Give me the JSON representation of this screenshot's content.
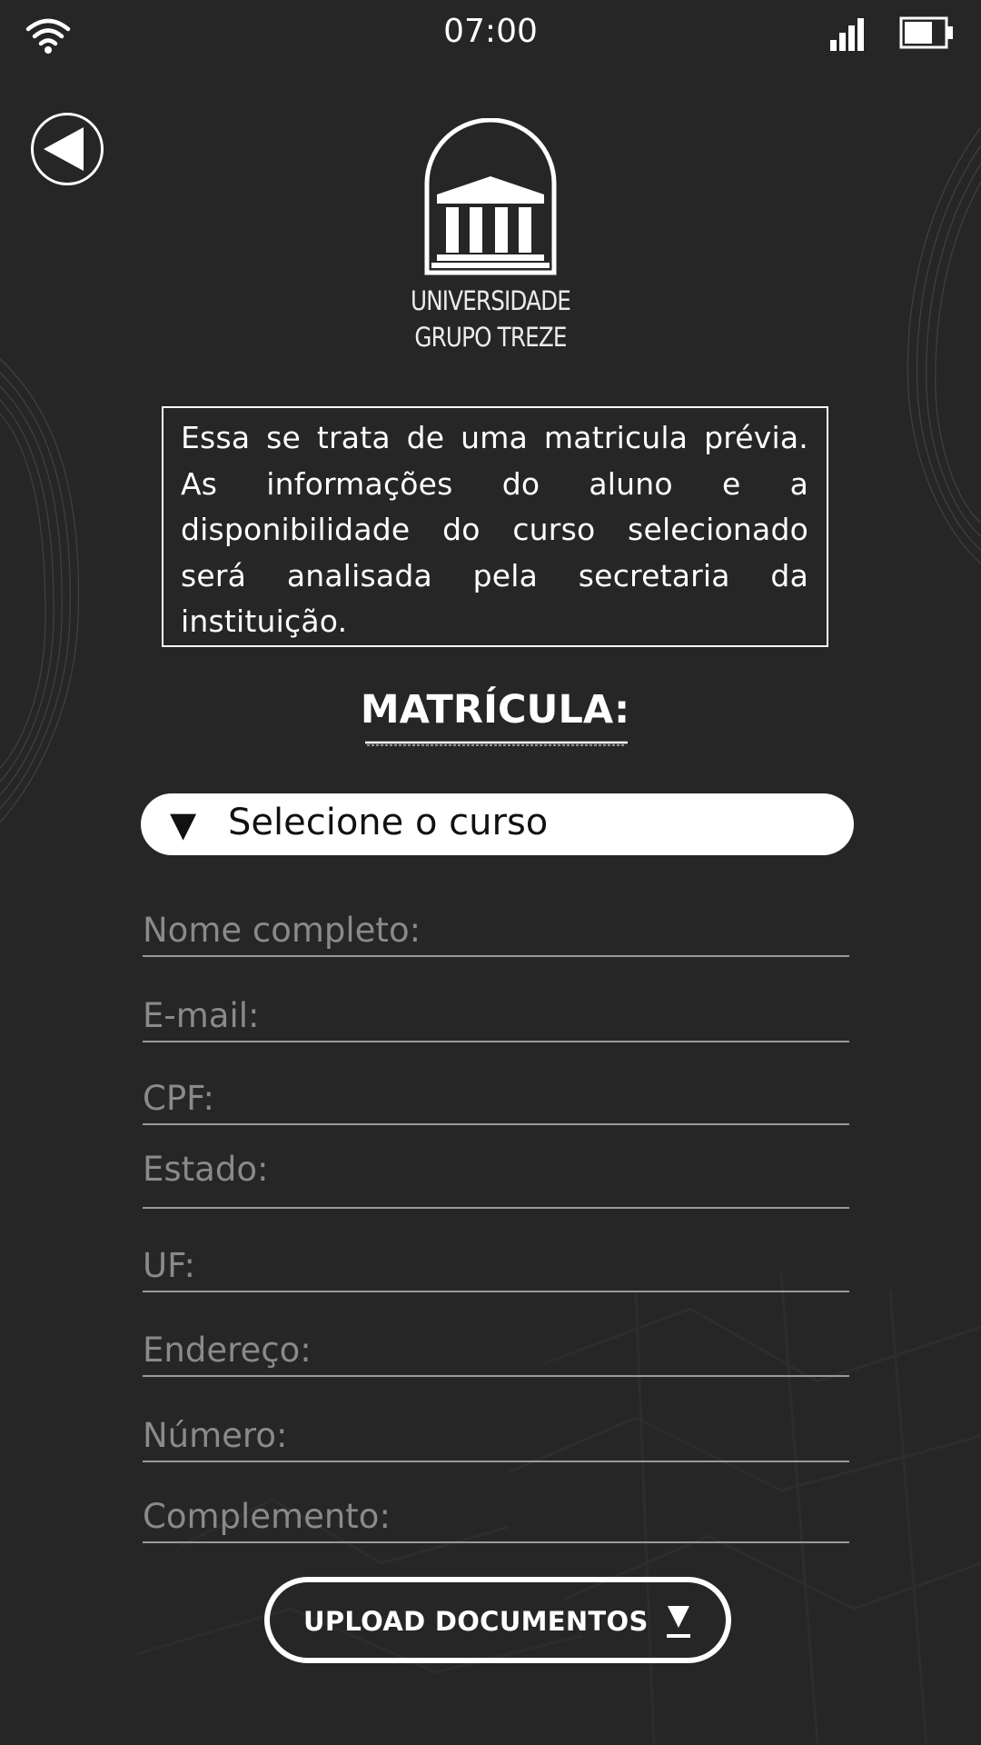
{
  "status_bar": {
    "time": "07:00",
    "icons": [
      "wifi-icon",
      "signal-icon",
      "battery-icon"
    ]
  },
  "navigation": {
    "back_icon": "back-arrow-icon"
  },
  "logo": {
    "emblem": "university-building-icon",
    "line1": "UNIVERSIDADE",
    "line2": "GRUPO TREZE"
  },
  "notice": {
    "text": "Essa se trata de uma matricula prévia. As informações do aluno e  a disponibilidade  do curso selecionado será analisada pela secretaria da instituição."
  },
  "form": {
    "title": "MATRÍCULA:",
    "course_select": {
      "icon": "dropdown-triangle-icon",
      "arrow": "▼",
      "label": "Selecione o curso"
    },
    "fields": {
      "name": "Nome completo:",
      "email": "E-mail:",
      "cpf": "CPF:",
      "state": "Estado:",
      "uf": "UF:",
      "address": "Endereço:",
      "number": "Número:",
      "complement": "Complemento:"
    },
    "upload_button": {
      "label": "UPLOAD DOCUMENTOS",
      "icon": "download-arrow-icon"
    }
  },
  "colors": {
    "background": "#262626",
    "foreground": "#ffffff",
    "placeholder": "#8a8a8a",
    "field_line": "#9a9a9a"
  }
}
